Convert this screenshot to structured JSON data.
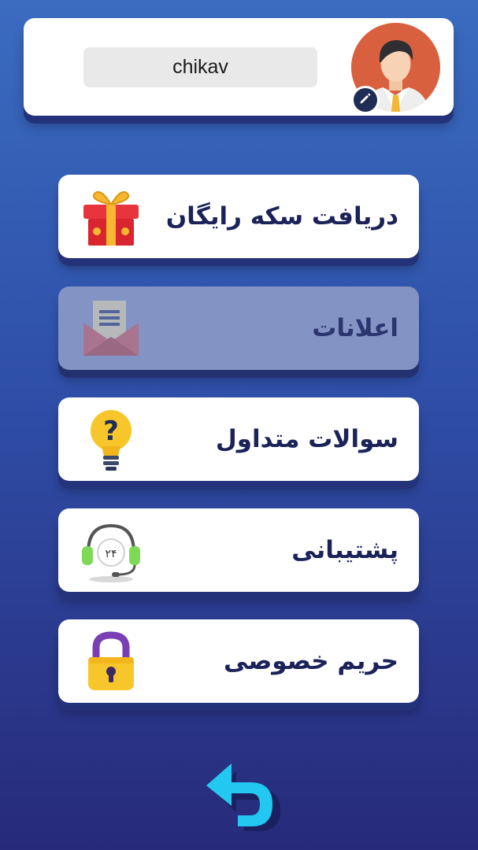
{
  "profile": {
    "username": "chikav",
    "avatar_icon": "user-avatar-icon",
    "edit_icon": "pencil-icon"
  },
  "menu": [
    {
      "id": "free-coins",
      "label": "دریافت سکه رایگان",
      "icon": "gift-icon",
      "enabled": true
    },
    {
      "id": "notifications",
      "label": "اعلانات",
      "icon": "envelope-icon",
      "enabled": false
    },
    {
      "id": "faq",
      "label": "سوالات متداول",
      "icon": "lightbulb-question-icon",
      "enabled": true
    },
    {
      "id": "support",
      "label": "پشتیبانی",
      "icon": "headset-24-icon",
      "enabled": true
    },
    {
      "id": "privacy",
      "label": "حریم خصوصی",
      "icon": "padlock-icon",
      "enabled": true
    }
  ],
  "support_badge": "۲۴",
  "back_icon": "back-arrow-icon",
  "colors": {
    "background_top": "#3a6cc0",
    "background_bottom": "#272a7a",
    "label_text": "#1b2258",
    "avatar_bg": "#d9603f",
    "back_arrow": "#23c8f0"
  }
}
